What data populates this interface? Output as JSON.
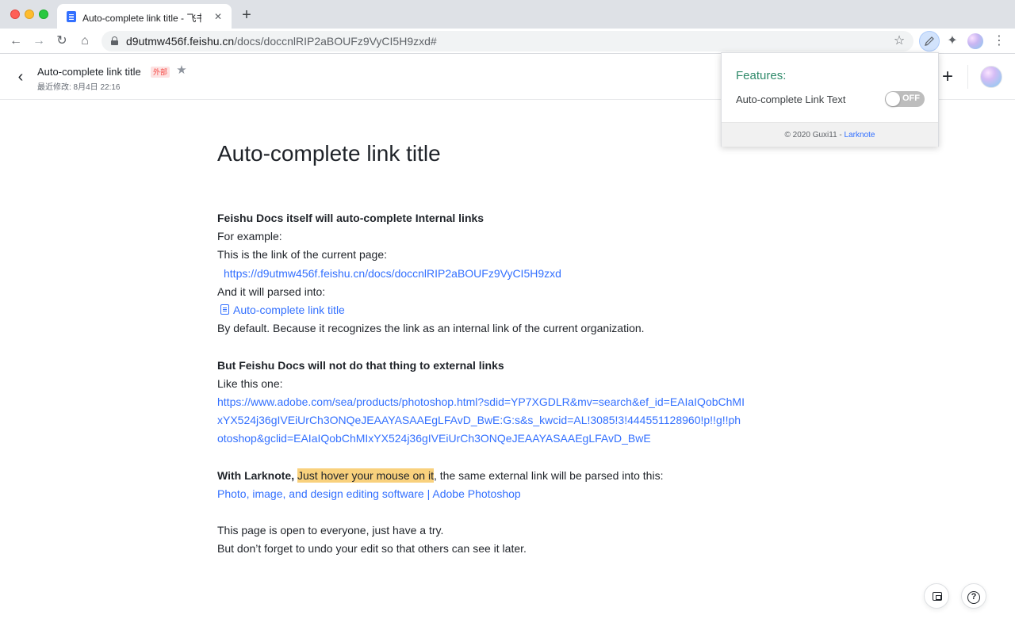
{
  "browser": {
    "tab": {
      "title": "Auto-complete link title - 飞书云文档",
      "close_glyph": "✕"
    },
    "new_tab_glyph": "+",
    "url": {
      "host": "d9utmw456f.feishu.cn",
      "path": "/docs/doccnlRIP2aBOUFz9VyCI5H9zxd#"
    }
  },
  "doc_header": {
    "title": "Auto-complete link title",
    "badge": "外部",
    "last_modified": "最近修改: 8月4日 22:16"
  },
  "document": {
    "title": "Auto-complete link title",
    "section1": {
      "heading": "Feishu Docs itself will auto-complete Internal links",
      "example": "For example:",
      "intro": "This is the link of the current page:",
      "link": "https://d9utmw456f.feishu.cn/docs/doccnlRIP2aBOUFz9VyCI5H9zxd",
      "parsed_intro": "And it will parsed into:",
      "parsed_link": "Auto-complete link title",
      "reason": "By default. Because it recognizes the link as an internal link of the current organization."
    },
    "section2": {
      "heading": "But Feishu Docs will not do that thing to external links",
      "intro": "Like this one:",
      "link": "https://www.adobe.com/sea/products/photoshop.html?sdid=YP7XGDLR&mv=search&ef_id=EAIaIQobChMIxYX524j36gIVEiUrCh3ONQeJEAAYASAAEgLFAvD_BwE:G:s&s_kwcid=AL!3085!3!444551128960!p!!g!!photoshop&gclid=EAIaIQobChMIxYX524j36gIVEiUrCh3ONQeJEAAYASAAEgLFAvD_BwE"
    },
    "section3": {
      "bold_lead": "With Larknote,",
      "highlight": "Just hover your mouse on it",
      "rest": ", the same external link will be parsed into this:",
      "parsed_link": "Photo, image, and design editing software | Adobe Photoshop"
    },
    "closing": {
      "line1": "This page is open to everyone, just have a try.",
      "line2": "But don’t forget to undo your edit so that others can see it later."
    }
  },
  "popup": {
    "heading": "Features:",
    "feature_label": "Auto-complete Link Text",
    "toggle_state": "OFF",
    "footer_text": "© 2020 Guxi11 - ",
    "footer_link": "Larknote"
  },
  "colors": {
    "link": "#3370ff",
    "highlight": "#f9d17d",
    "popup_heading": "#2f8a6a",
    "badge_text": "#f54a45"
  },
  "icons": {
    "back": "back-arrow-icon",
    "forward": "forward-arrow-icon",
    "reload": "reload-icon",
    "home": "home-icon",
    "lock": "lock-icon",
    "star": "star-icon",
    "extension": "pen-icon",
    "puzzle": "puzzle-icon",
    "menu": "kebab-menu-icon",
    "doc": "document-icon",
    "help": "question-icon"
  }
}
